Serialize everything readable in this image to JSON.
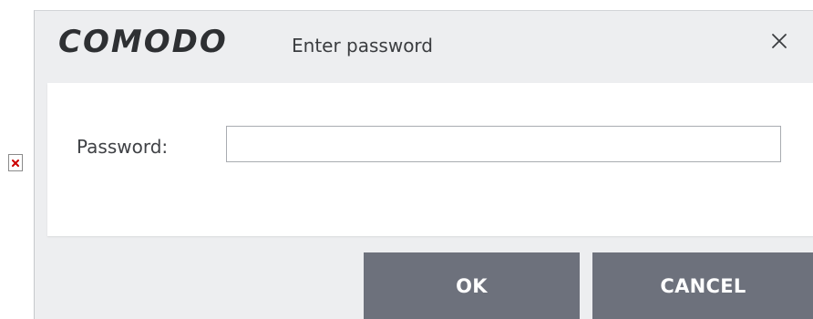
{
  "dialog": {
    "brand": "COMODO",
    "title": "Enter password",
    "close_icon": "close-icon"
  },
  "form": {
    "password_label": "Password:",
    "password_value": "",
    "password_placeholder": ""
  },
  "buttons": {
    "ok_label": "OK",
    "cancel_label": "CANCEL"
  },
  "colors": {
    "dialog_background": "#edeef0",
    "button_background": "#6d717c",
    "button_text": "#ffffff",
    "panel_background": "#ffffff",
    "broken_image_mark": "#cc0000"
  },
  "icons": {
    "broken_image": "broken-image-icon",
    "close": "close-icon"
  }
}
